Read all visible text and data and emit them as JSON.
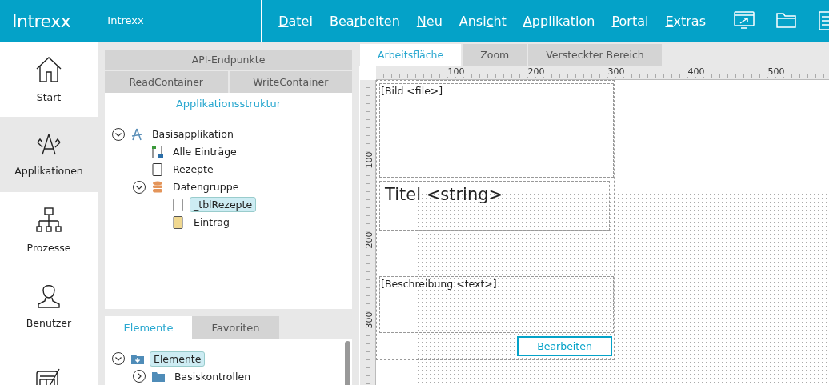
{
  "header": {
    "logo": "Intrexx",
    "portal": "Intrexx",
    "menu": [
      {
        "key": "D",
        "after": "atei"
      },
      {
        "before": "Bea",
        "key": "r",
        "after": "beiten"
      },
      {
        "key": "N",
        "after": "eu"
      },
      {
        "before": "Ansi",
        "key": "c",
        "after": "ht"
      },
      {
        "key": "A",
        "after": "pplikation"
      },
      {
        "key": "P",
        "after": "ortal"
      },
      {
        "key": "E",
        "after": "xtras"
      }
    ]
  },
  "sidebar": {
    "items": [
      {
        "kind": "home",
        "label": "Start",
        "selected": false
      },
      {
        "kind": "apps",
        "label": "Applikationen",
        "selected": true
      },
      {
        "kind": "processes",
        "label": "Prozesse",
        "selected": false
      },
      {
        "kind": "user",
        "label": "Benutzer",
        "selected": false
      },
      {
        "kind": "design",
        "selected": false
      }
    ]
  },
  "structure": {
    "top_tab": "API-Endpunkte",
    "tabs": [
      {
        "label": "ReadContainer",
        "selected": false
      },
      {
        "label": "WriteContainer",
        "selected": false
      }
    ],
    "title": "Applikationsstruktur",
    "tree": [
      {
        "kind": "app",
        "label": "Basisapplikation",
        "expanded": true,
        "selected": false,
        "children": [
          {
            "kind": "view",
            "label": "Alle Einträge",
            "selected": false
          },
          {
            "kind": "page",
            "label": "Rezepte",
            "selected": false
          },
          {
            "kind": "datagroup",
            "label": "Datengruppe",
            "expanded": true,
            "selected": false,
            "children": [
              {
                "kind": "page",
                "label": "_tblRezepte",
                "selected": true
              },
              {
                "kind": "record",
                "label": "Eintrag",
                "selected": false
              }
            ]
          }
        ]
      }
    ]
  },
  "elements": {
    "tabs": [
      {
        "label": "Elemente",
        "selected": true
      },
      {
        "label": "Favoriten",
        "selected": false
      }
    ],
    "tree": [
      {
        "kind": "download-folder",
        "label": "Elemente",
        "expanded": true,
        "selected": true,
        "children": [
          {
            "kind": "folder",
            "label": "Basiskontrollen",
            "expanded": false,
            "selected": false
          }
        ]
      }
    ]
  },
  "editor": {
    "tabs": [
      {
        "label": "Arbeitsfläche",
        "selected": true
      },
      {
        "label": "Zoom",
        "selected": false
      },
      {
        "label": "Versteckter Bereich",
        "selected": false
      }
    ],
    "x_ruler": [
      "100",
      "200",
      "300",
      "400",
      "500"
    ],
    "y_ruler": [
      "100",
      "200",
      "300"
    ],
    "controls": [
      {
        "kind": "image",
        "label": "[Bild <file>]"
      },
      {
        "kind": "title",
        "label": "Titel <string>"
      },
      {
        "kind": "text",
        "label": "[Beschreibung <text>]"
      },
      {
        "kind": "button",
        "label": "Bearbeiten"
      }
    ]
  }
}
